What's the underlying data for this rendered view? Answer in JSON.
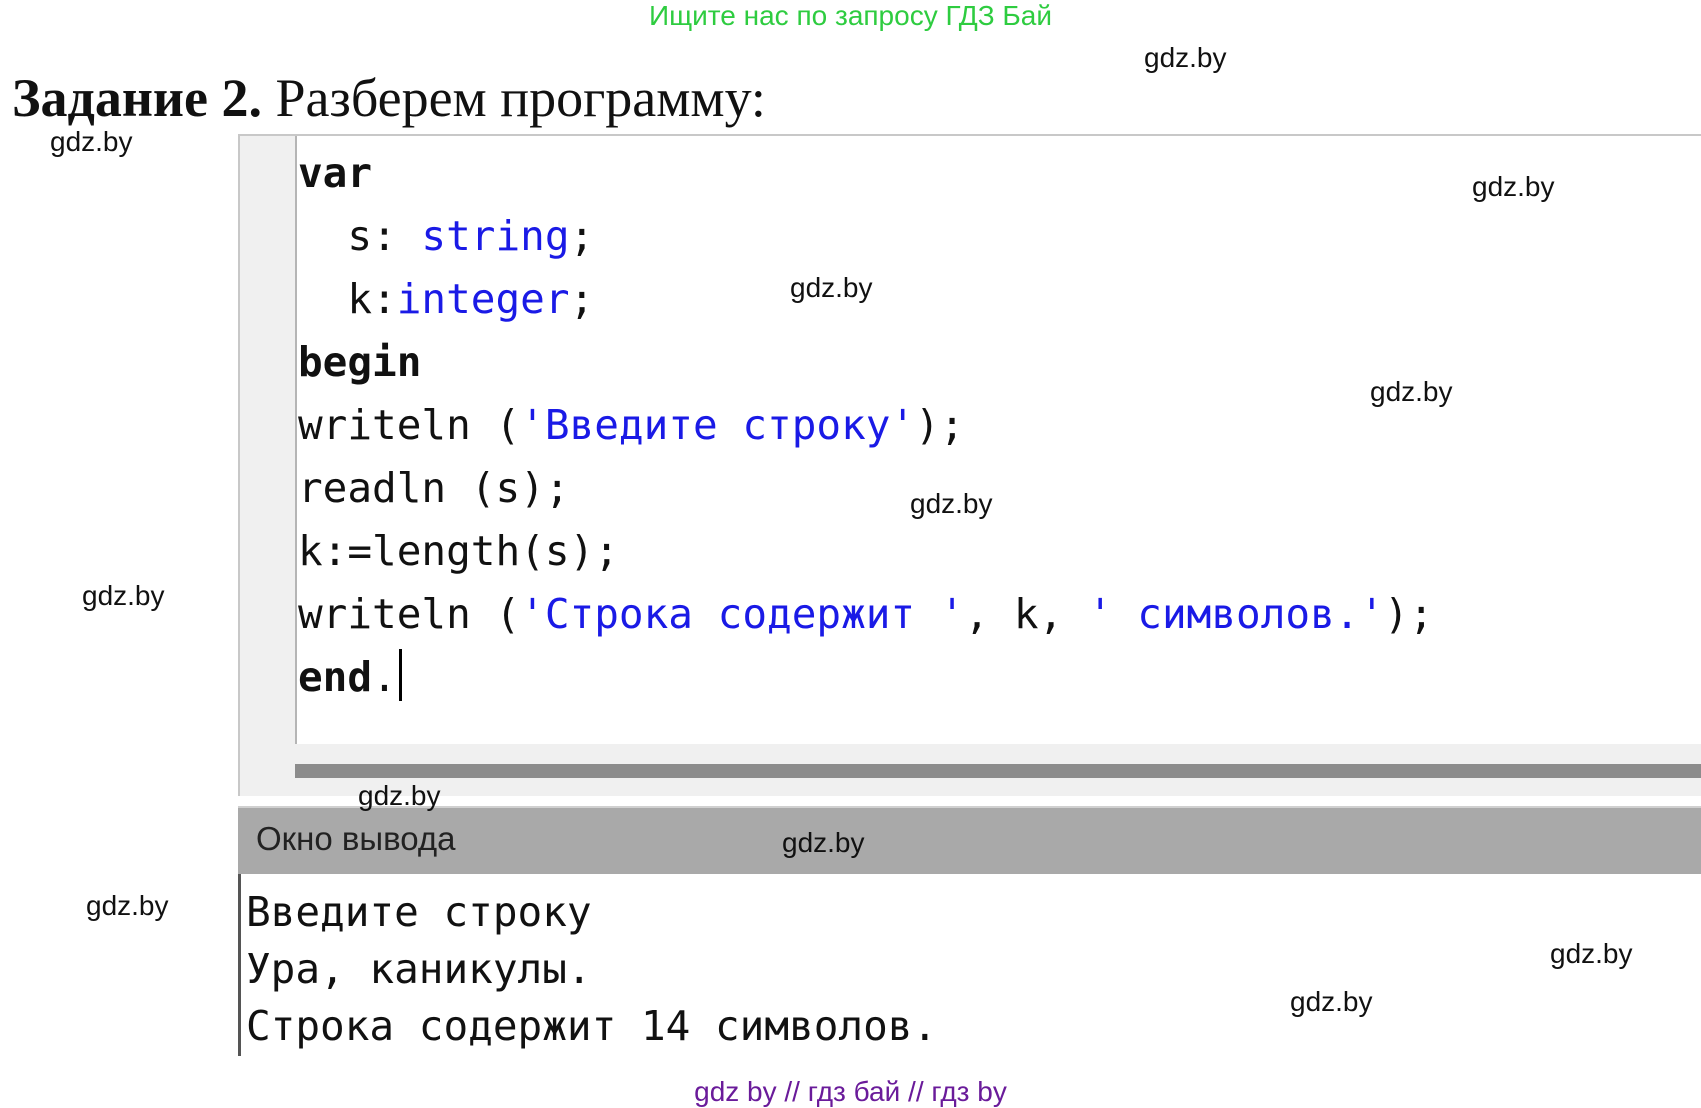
{
  "banner": "Ищите нас по запросу ГДЗ Бай",
  "task": {
    "label": "Задание 2.",
    "text": "Разберем программу:"
  },
  "watermark": "gdz.by",
  "code": {
    "l1_kw": "var",
    "l2_a": "  s: ",
    "l2_type": "string",
    "l2_b": ";",
    "l3_a": "  k:",
    "l3_type": "integer",
    "l3_b": ";",
    "l4_kw": "begin",
    "l5_a": "writeln (",
    "l5_str": "'Введите строку'",
    "l5_b": ");",
    "l6": "readln (s);",
    "l7": "k:=length(s);",
    "l8_a": "writeln (",
    "l8_str1": "'Строка содержит '",
    "l8_b": ", k, ",
    "l8_str2": "' символов.'",
    "l8_c": ");",
    "l9_kw": "end",
    "l9_b": "."
  },
  "output_window": {
    "title": "Окно вывода",
    "lines": [
      "Введите строку",
      "Ура, каникулы.",
      "Строка содержит 14 символов."
    ]
  },
  "footer": "gdz by  //  гдз бай  //  гдз by"
}
